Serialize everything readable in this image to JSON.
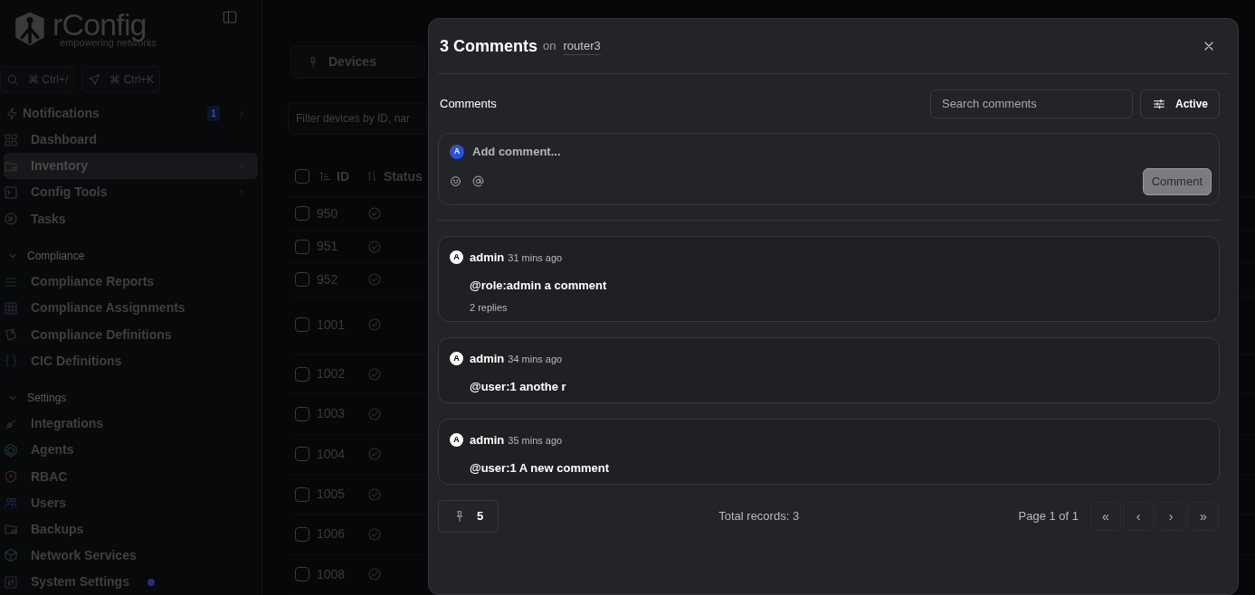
{
  "sidebar": {
    "logo": {
      "name": "rConfig",
      "tagline": "empowering networks"
    },
    "shortcuts": [
      "⌘ Ctrl+/",
      "⌘ Ctrl+K"
    ],
    "items": [
      {
        "kind": "item",
        "label": "Notifications",
        "badge": "1",
        "has_children": true,
        "selected": false
      },
      {
        "kind": "item",
        "label": "Dashboard",
        "has_children": false,
        "selected": false
      },
      {
        "kind": "item",
        "label": "Inventory",
        "has_children": true,
        "selected": true
      },
      {
        "kind": "item",
        "label": "Config Tools",
        "has_children": true,
        "selected": false
      },
      {
        "kind": "item",
        "label": "Tasks",
        "has_children": false,
        "selected": false
      },
      {
        "kind": "section",
        "label": "Compliance",
        "expanded": true
      },
      {
        "kind": "item",
        "label": "Compliance Reports",
        "has_children": false,
        "selected": false
      },
      {
        "kind": "item",
        "label": "Compliance Assignments",
        "has_children": false,
        "selected": false
      },
      {
        "kind": "item",
        "label": "Compliance Definitions",
        "has_children": false,
        "selected": false
      },
      {
        "kind": "item",
        "label": "CIC Definitions",
        "has_children": false,
        "selected": false
      },
      {
        "kind": "section",
        "label": "Settings",
        "expanded": true
      },
      {
        "kind": "item",
        "label": "Integrations",
        "has_children": false,
        "selected": false
      },
      {
        "kind": "item",
        "label": "Agents",
        "has_children": false,
        "selected": false
      },
      {
        "kind": "item",
        "label": "RBAC",
        "has_children": false,
        "selected": false
      },
      {
        "kind": "item",
        "label": "Users",
        "has_children": false,
        "selected": false
      },
      {
        "kind": "item",
        "label": "Backups",
        "has_children": false,
        "selected": false
      },
      {
        "kind": "item",
        "label": "Network Services",
        "has_children": false,
        "selected": false
      },
      {
        "kind": "item",
        "label": "System Settings",
        "has_children": false,
        "selected": false,
        "color": "#2e2a7a"
      }
    ]
  },
  "main": {
    "tab": "Devices",
    "filter": {
      "placeholder": "Filter devices by ID, nar"
    },
    "all_checked": false,
    "columns": [
      "ID",
      "Status"
    ],
    "rows": [
      {
        "id": "950",
        "checked": false
      },
      {
        "id": "951",
        "checked": false
      },
      {
        "id": "952",
        "checked": false
      },
      {
        "id": "1001",
        "checked": false
      },
      {
        "id": "1002",
        "checked": false
      },
      {
        "id": "1003",
        "checked": false
      },
      {
        "id": "1004",
        "checked": false
      },
      {
        "id": "1005",
        "checked": false
      },
      {
        "id": "1006",
        "checked": false
      },
      {
        "id": "1008",
        "checked": false
      }
    ]
  },
  "modal": {
    "title": "3 Comments",
    "title_on": "on",
    "device": "router3",
    "section_label": "Comments",
    "search": {
      "placeholder": "Search comments"
    },
    "filter_button": "Active",
    "composer": {
      "avatar": "A",
      "placeholder": "Add comment...",
      "button": "Comment",
      "disabled": true
    },
    "comments": [
      {
        "avatar": "A",
        "author": "admin",
        "time": "31 mins ago",
        "text": "@role:admin a comment",
        "replies": "2 replies"
      },
      {
        "avatar": "A",
        "author": "admin",
        "time": "34 mins ago",
        "text": "@user:1 anothe r"
      },
      {
        "avatar": "A",
        "author": "admin",
        "time": "35 mins ago",
        "text": "@user:1 A new comment"
      }
    ],
    "footer": {
      "pinned": "5",
      "total": "Total records: 3",
      "page": "Page 1 of 1",
      "nav": [
        "«",
        "‹",
        "›",
        "»"
      ]
    }
  }
}
